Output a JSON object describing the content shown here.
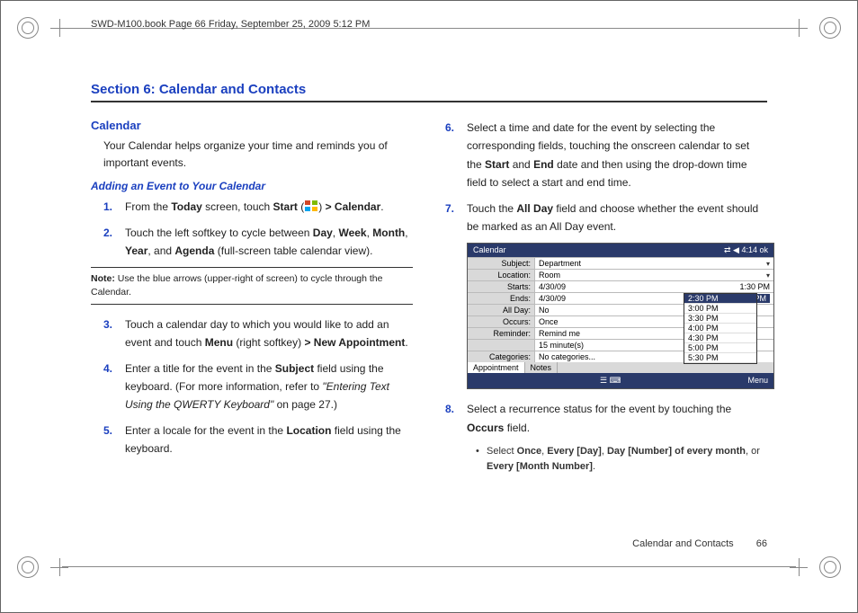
{
  "crop_header": "SWD-M100.book  Page 66  Friday, September 25, 2009  5:12 PM",
  "section_title": "Section 6: Calendar and Contacts",
  "left": {
    "h_calendar": "Calendar",
    "intro": "Your Calendar helps organize your time and reminds you of important events.",
    "h_adding": "Adding an Event to Your Calendar",
    "s1": {
      "num": "1.",
      "pre": "From the ",
      "bold1": "Today",
      "mid": " screen, touch ",
      "bold2": "Start",
      "paren_open": " (",
      "paren_close": ") ",
      "bold3": "> Calendar",
      "end": "."
    },
    "s2": {
      "num": "2.",
      "pre": "Touch the left softkey to cycle between ",
      "b1": "Day",
      "c1": ", ",
      "b2": "Week",
      "c2": ", ",
      "b3": "Month",
      "c3": ", ",
      "b4": "Year",
      "c4": ", and ",
      "b5": "Agenda",
      "end": " (full-screen table calendar view)."
    },
    "note_label": "Note:",
    "note_text": " Use the blue arrows (upper-right of screen) to cycle through the Calendar.",
    "s3": {
      "num": "3.",
      "pre": "Touch a calendar day to which you would like to add an event and touch ",
      "b1": "Menu",
      "mid": " (right softkey) ",
      "b2": "> New Appointment",
      "end": "."
    },
    "s4": {
      "num": "4.",
      "pre": "Enter a title for the event in the ",
      "b1": "Subject",
      "mid": " field using the keyboard. (For more information, refer to ",
      "ital": "\"Entering Text Using the QWERTY Keyboard\" ",
      "end": " on page 27.)"
    },
    "s5": {
      "num": "5.",
      "pre": "Enter a locale for the event in the ",
      "b1": "Location",
      "end": " field using the keyboard."
    }
  },
  "right": {
    "s6": {
      "num": "6.",
      "pre": "Select a time and date for the event by selecting the corresponding fields, touching the onscreen calendar to set the ",
      "b1": "Start",
      "mid": " and ",
      "b2": "End",
      "end": " date and then using the drop-down time field to select a start and end time."
    },
    "s7": {
      "num": "7.",
      "pre": "Touch the ",
      "b1": "All Day",
      "end": " field and choose whether the event should be marked as an All Day event."
    },
    "shot": {
      "title_left": "Calendar",
      "title_right": "⇄  ◀  4:14   ok",
      "rows": {
        "subject": {
          "label": "Subject:",
          "value": "Department"
        },
        "location": {
          "label": "Location:",
          "value": "Room"
        },
        "starts": {
          "label": "Starts:",
          "value": "4/30/09",
          "right": "1:30 PM"
        },
        "ends": {
          "label": "Ends:",
          "value": "4/30/09",
          "right_sel": "2:30 PM"
        },
        "allday": {
          "label": "All Day:",
          "value": "No"
        },
        "occurs": {
          "label": "Occurs:",
          "value": "Once"
        },
        "reminder": {
          "label": "Reminder:",
          "value": "Remind me"
        },
        "reminder2": {
          "label": "",
          "value": "15   minute(s)"
        },
        "categories": {
          "label": "Categories:",
          "value": "No categories..."
        }
      },
      "dropdown": [
        "2:30 PM",
        "3:00 PM",
        "3:30 PM",
        "4:00 PM",
        "4:30 PM",
        "5:00 PM",
        "5:30 PM"
      ],
      "tabs": {
        "t1": "Appointment",
        "t2": "Notes"
      },
      "bottom_left": "",
      "bottom_center": "☰ ⌨",
      "bottom_right": "Menu"
    },
    "s8": {
      "num": "8.",
      "pre": "Select a recurrence status for the event by touching the ",
      "b1": "Occurs",
      "end": " field."
    },
    "bullet": {
      "dot": "•",
      "pre": "Select ",
      "b1": "Once",
      "c1": ", ",
      "b2": "Every [Day]",
      "c2": ", ",
      "b3": "Day [Number] of every month",
      "c3": ", or ",
      "b4": "Every [Month Number]",
      "end": "."
    }
  },
  "footer": {
    "text": "Calendar and Contacts",
    "page": "66"
  }
}
